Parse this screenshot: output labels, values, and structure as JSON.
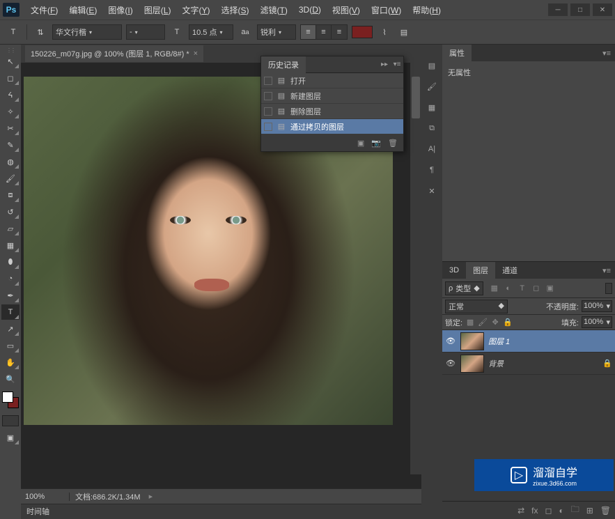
{
  "app": {
    "logo": "Ps"
  },
  "menu": [
    {
      "label": "文件",
      "accel": "F"
    },
    {
      "label": "编辑",
      "accel": "E"
    },
    {
      "label": "图像",
      "accel": "I"
    },
    {
      "label": "图层",
      "accel": "L"
    },
    {
      "label": "文字",
      "accel": "Y"
    },
    {
      "label": "选择",
      "accel": "S"
    },
    {
      "label": "滤镜",
      "accel": "T"
    },
    {
      "label": "3D",
      "accel": "D"
    },
    {
      "label": "视图",
      "accel": "V"
    },
    {
      "label": "窗口",
      "accel": "W"
    },
    {
      "label": "帮助",
      "accel": "H"
    }
  ],
  "options": {
    "font_family": "华文行楷",
    "font_style": "-",
    "font_size": "10.5 点",
    "antialias": "锐利",
    "text_color": "#7a2020"
  },
  "document": {
    "tab_title": "150226_m07g.jpg @ 100% (图层 1, RGB/8#) *",
    "zoom": "100%",
    "status": "文档:686.2K/1.34M"
  },
  "timeline": {
    "tab": "时间轴"
  },
  "history": {
    "title": "历史记录",
    "items": [
      {
        "label": "打开"
      },
      {
        "label": "新建图层"
      },
      {
        "label": "删除图层"
      },
      {
        "label": "通过拷贝的图层"
      }
    ]
  },
  "properties": {
    "tab": "属性",
    "body": "无属性"
  },
  "layers_panel": {
    "tabs": [
      "3D",
      "图层",
      "通道"
    ],
    "active_tab": 1,
    "filter_kind": "类型",
    "blend_mode": "正常",
    "opacity_label": "不透明度:",
    "opacity_value": "100%",
    "lock_label": "锁定:",
    "fill_label": "填充:",
    "fill_value": "100%",
    "layers": [
      {
        "name": "图层 1",
        "visible": true,
        "selected": true
      },
      {
        "name": "背景",
        "visible": true,
        "selected": false
      }
    ]
  },
  "watermark": {
    "text": "溜溜自学",
    "sub": "zixue.3d66.com"
  }
}
